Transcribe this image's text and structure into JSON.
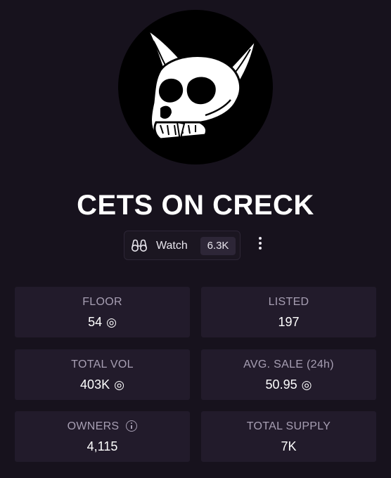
{
  "collection": {
    "name": "CETS ON CRECK",
    "avatar_icon": "cat-skull-icon"
  },
  "watch": {
    "label": "Watch",
    "count": "6.3K",
    "icon": "binoculars-icon",
    "more_icon": "vertical-ellipsis-icon"
  },
  "stats": {
    "floor": {
      "label": "FLOOR",
      "value": "54",
      "unit": "◎"
    },
    "listed": {
      "label": "LISTED",
      "value": "197"
    },
    "total_vol": {
      "label": "TOTAL VOL",
      "value": "403K",
      "unit": "◎"
    },
    "avg_sale": {
      "label": "AVG. SALE (24h)",
      "value": "50.95",
      "unit": "◎"
    },
    "owners": {
      "label": "OWNERS",
      "value": "4,115",
      "icon": "info-icon"
    },
    "total_supply": {
      "label": "TOTAL SUPPLY",
      "value": "7K"
    }
  },
  "colors": {
    "background": "#17121d",
    "card": "#221b2b",
    "label": "#a79fb3",
    "text": "#ffffff"
  }
}
